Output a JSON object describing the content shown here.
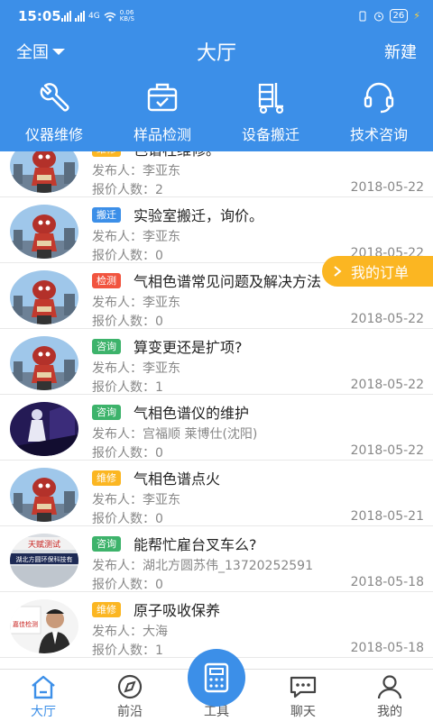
{
  "status": {
    "time": "15:05",
    "network": "4G",
    "speed_value": "0.06",
    "speed_unit": "KB/S",
    "battery": "26"
  },
  "header": {
    "region": "全国",
    "title": "大厅",
    "new_label": "新建"
  },
  "categories": [
    {
      "label": "仪器维修",
      "icon": "wrench-icon"
    },
    {
      "label": "样品检测",
      "icon": "sample-box-icon"
    },
    {
      "label": "设备搬迁",
      "icon": "moving-cart-icon"
    },
    {
      "label": "技术咨询",
      "icon": "headset-icon"
    }
  ],
  "floating": {
    "label": "我的订单"
  },
  "colors": {
    "primary": "#3c8fe8",
    "repair": "#fbb622",
    "moving": "#3c8fe8",
    "testing": "#f1543f",
    "consult": "#3db36b"
  },
  "items": [
    {
      "tag": "维修",
      "tag_type": "repair",
      "title": "色谱柱维修。",
      "publisher_label": "发布人：",
      "publisher": "李亚东",
      "quote_label": "报价人数：",
      "quote": "2",
      "date": "2018-05-22",
      "avatar": "robot"
    },
    {
      "tag": "搬迁",
      "tag_type": "moving",
      "title": "实验室搬迁，询价。",
      "publisher_label": "发布人：",
      "publisher": "李亚东",
      "quote_label": "报价人数：",
      "quote": "0",
      "date": "2018-05-22",
      "avatar": "robot"
    },
    {
      "tag": "检测",
      "tag_type": "testing",
      "title": "气相色谱常见问题及解决方法",
      "publisher_label": "发布人：",
      "publisher": "李亚东",
      "quote_label": "报价人数：",
      "quote": "0",
      "date": "2018-05-22",
      "avatar": "robot"
    },
    {
      "tag": "咨询",
      "tag_type": "consult",
      "title": "算变更还是扩项?",
      "publisher_label": "发布人：",
      "publisher": "李亚东",
      "quote_label": "报价人数：",
      "quote": "1",
      "date": "2018-05-22",
      "avatar": "robot"
    },
    {
      "tag": "咨询",
      "tag_type": "consult",
      "title": "气相色谱仪的维护",
      "publisher_label": "发布人：",
      "publisher": "宫福顺 莱博仕(沈阳)",
      "quote_label": "报价人数：",
      "quote": "0",
      "date": "2018-05-22",
      "avatar": "dark"
    },
    {
      "tag": "维修",
      "tag_type": "repair",
      "title": "气相色谱点火",
      "publisher_label": "发布人：",
      "publisher": "李亚东",
      "quote_label": "报价人数：",
      "quote": "0",
      "date": "2018-05-21",
      "avatar": "robot"
    },
    {
      "tag": "咨询",
      "tag_type": "consult",
      "title": "能帮忙雇台叉车么?",
      "publisher_label": "发布人：",
      "publisher": "湖北方圆苏伟_13720252591",
      "quote_label": "报价人数：",
      "quote": "0",
      "date": "2018-05-18",
      "avatar": "company",
      "avatar_text_1": "湖北方圆环保科技有",
      "avatar_text_2": "天赋测试"
    },
    {
      "tag": "维修",
      "tag_type": "repair",
      "title": "原子吸收保养",
      "publisher_label": "发布人：",
      "publisher": "大海",
      "quote_label": "报价人数：",
      "quote": "1",
      "date": "2018-05-18",
      "avatar": "person",
      "avatar_text_1": "嘉佳检测"
    }
  ],
  "nav": [
    {
      "label": "大厅",
      "icon": "home-icon",
      "active": true
    },
    {
      "label": "前沿",
      "icon": "compass-icon",
      "active": false
    },
    {
      "label": "工具",
      "icon": "calculator-icon",
      "active": false
    },
    {
      "label": "聊天",
      "icon": "chat-icon",
      "active": false
    },
    {
      "label": "我的",
      "icon": "user-icon",
      "active": false
    }
  ]
}
